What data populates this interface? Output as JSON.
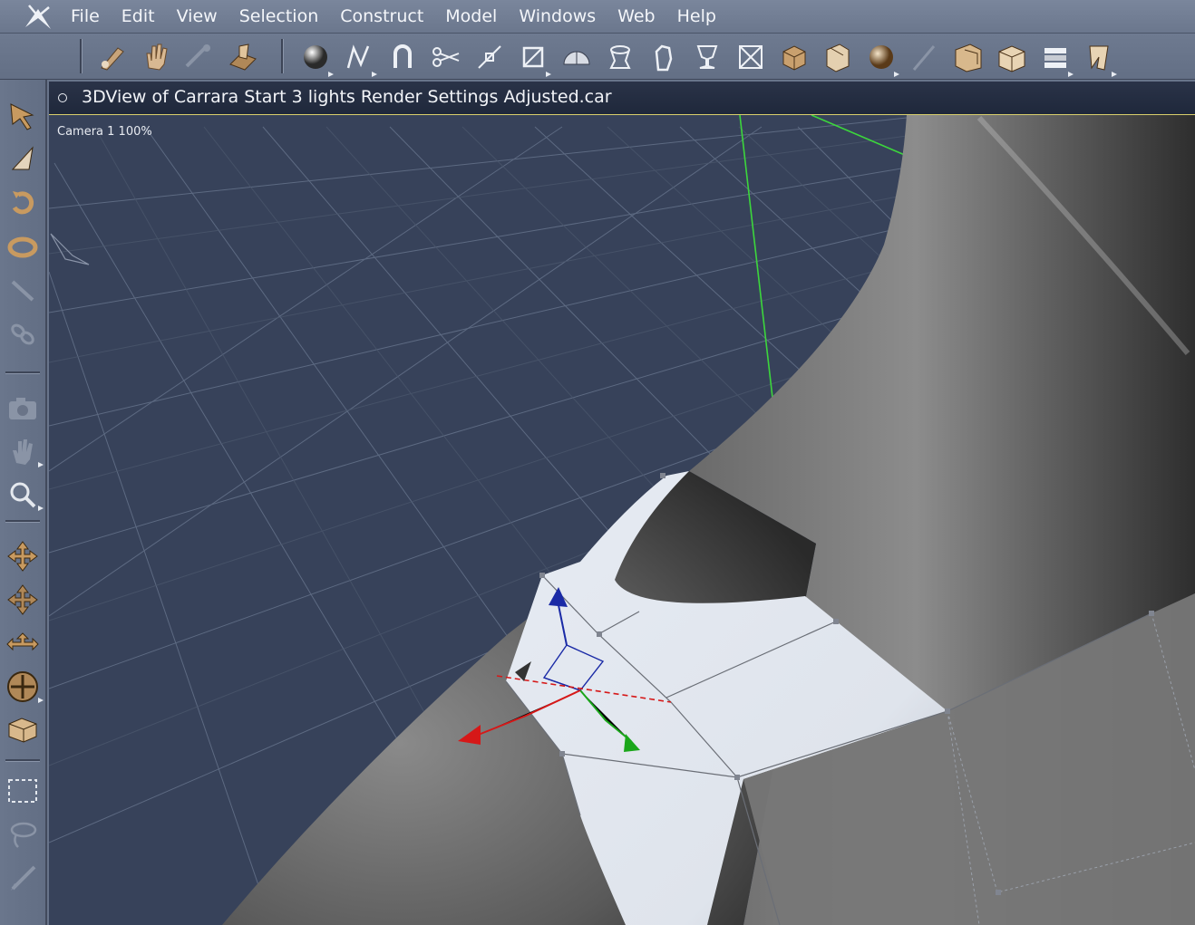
{
  "menu": {
    "items": [
      "File",
      "Edit",
      "View",
      "Selection",
      "Construct",
      "Model",
      "Windows",
      "Web",
      "Help"
    ]
  },
  "view": {
    "title": "3DView of Carrara Start 3 lights Render Settings Adjusted.car",
    "camera_label": "Camera 1 100%"
  },
  "toolbar": {
    "tools": [
      "draw-tool",
      "hand-pan-tool",
      "scissor-tool-disabled",
      "assemble-tool",
      "sphere-primitive",
      "spline-object",
      "magnet-tool",
      "cut-tool",
      "link-tool",
      "bounding-box-tool",
      "half-sphere",
      "shader-tool",
      "hand-tool",
      "goblet-tool",
      "frame-tool",
      "cube-object",
      "box-sculpt",
      "ball-object",
      "brush-disabled",
      "room-tool",
      "terrain-tool",
      "scene-tool",
      "cloth-tool"
    ]
  },
  "palette": {
    "tools": [
      "select-arrow",
      "select-arrow-variant",
      "rotate-tool",
      "ring-tool",
      "wand-tool",
      "link-tool",
      "camera-tool",
      "hand-tool",
      "zoom-tool",
      "move-tool",
      "move-xyz-tool",
      "move-plane-tool",
      "universal-manipulator",
      "floor-plane-tool",
      "rectangle-select",
      "lasso-select",
      "paint-select"
    ]
  },
  "colors": {
    "menubar": "#6f7b91",
    "viewport_bg": "#37425a",
    "grid_line": "#5d6a82",
    "axis_green": "#3cd63c",
    "gizmo_red": "#d61818",
    "gizmo_green": "#1aa61a",
    "gizmo_blue": "#1a2aa6",
    "selected_face": "#dfe5ee",
    "title_highlight": "#d9cf6b"
  }
}
